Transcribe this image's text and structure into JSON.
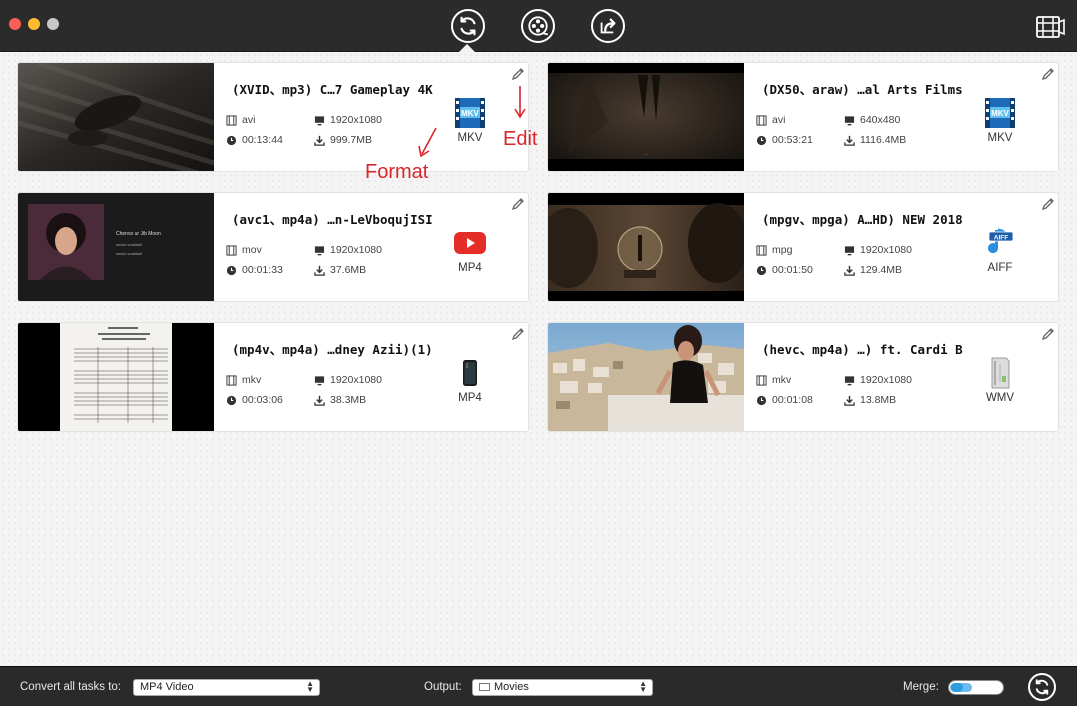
{
  "toolbar": {
    "tools": [
      {
        "name": "convert",
        "icon": "convert-icon",
        "active": true
      },
      {
        "name": "video-edit",
        "icon": "film-reel-icon",
        "active": false
      },
      {
        "name": "share",
        "icon": "share-icon",
        "active": false
      }
    ],
    "right_icon": "film-strip-icon"
  },
  "annotations": {
    "format": "Format",
    "edit": "Edit"
  },
  "tasks": [
    {
      "title": "(XVID、mp3) C…7 Gameplay 4K",
      "container": "avi",
      "resolution": "1920x1080",
      "duration": "00:13:44",
      "size": "999.7MB",
      "target_format": "MKV",
      "format_icon": "mkv-icon"
    },
    {
      "title": "(DX50、araw) …al Arts Films",
      "container": "avi",
      "resolution": "640x480",
      "duration": "00:53:21",
      "size": "1116.4MB",
      "target_format": "MKV",
      "format_icon": "mkv-icon"
    },
    {
      "title": "(avc1、mp4a) …n-LeVboqujISI",
      "container": "mov",
      "resolution": "1920x1080",
      "duration": "00:01:33",
      "size": "37.6MB",
      "target_format": "MP4",
      "format_icon": "youtube-icon"
    },
    {
      "title": "(mpgv、mpga) A…HD) NEW 2018",
      "container": "mpg",
      "resolution": "1920x1080",
      "duration": "00:01:50",
      "size": "129.4MB",
      "target_format": "AIFF",
      "format_icon": "aiff-icon"
    },
    {
      "title": "(mp4v、mp4a) …dney Azii)(1)",
      "container": "mkv",
      "resolution": "1920x1080",
      "duration": "00:03:06",
      "size": "38.3MB",
      "target_format": "MP4",
      "format_icon": "iphone-icon"
    },
    {
      "title": "(hevc、mp4a) …) ft. Cardi B",
      "container": "mkv",
      "resolution": "1920x1080",
      "duration": "00:01:08",
      "size": "13.8MB",
      "target_format": "WMV",
      "format_icon": "wmv-icon"
    }
  ],
  "thumb2_caption": "...",
  "thumb3_text": {
    "line1": "Chenso ur Jib Moon",
    "line2": "vecko vuukkell",
    "line3": "vecko vuukkell"
  },
  "bottom": {
    "convert_label": "Convert all tasks to:",
    "convert_value": "MP4 Video",
    "output_label": "Output:",
    "output_value": "Movies",
    "merge_label": "Merge:"
  },
  "colors": {
    "accent": "#2d9ce0",
    "annotation": "#d9262c",
    "toolbar_bg": "#2b2b2b"
  }
}
